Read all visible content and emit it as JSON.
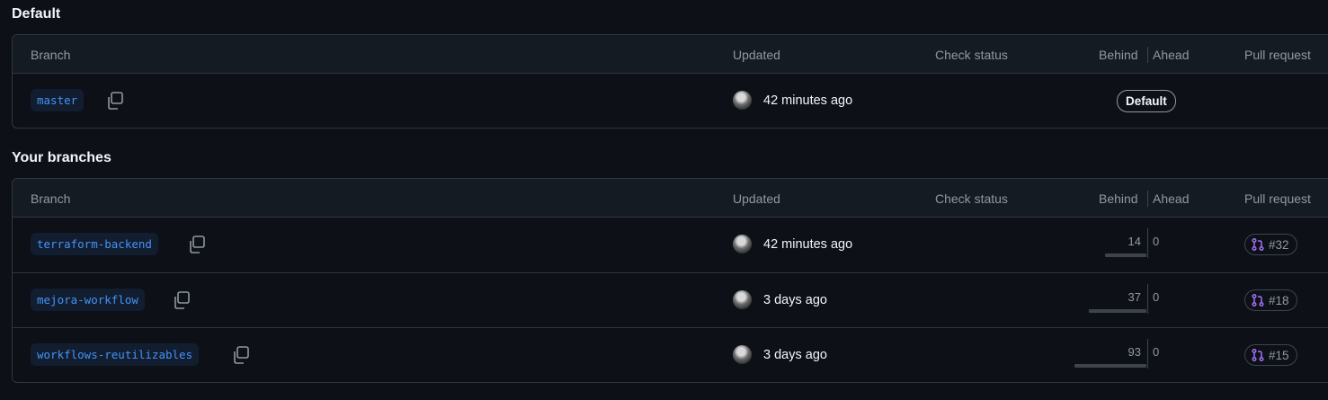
{
  "sections": [
    {
      "title": "Default",
      "headers": {
        "branch": "Branch",
        "updated": "Updated",
        "check_status": "Check status",
        "behind": "Behind",
        "ahead": "Ahead",
        "pull_request": "Pull request"
      },
      "rows": [
        {
          "name": "master",
          "updated": "42 minutes ago",
          "badge": "Default"
        }
      ]
    },
    {
      "title": "Your branches",
      "headers": {
        "branch": "Branch",
        "updated": "Updated",
        "check_status": "Check status",
        "behind": "Behind",
        "ahead": "Ahead",
        "pull_request": "Pull request"
      },
      "rows": [
        {
          "name": "terraform-backend",
          "updated": "42 minutes ago",
          "behind": "14",
          "ahead": "0",
          "pr": "#32"
        },
        {
          "name": "mejora-workflow",
          "updated": "3 days ago",
          "behind": "37",
          "ahead": "0",
          "pr": "#18"
        },
        {
          "name": "workflows-reutilizables",
          "updated": "3 days ago",
          "behind": "93",
          "ahead": "0",
          "pr": "#15"
        }
      ]
    }
  ],
  "colors": {
    "branch_accent": "#4493f8",
    "pr_open": "#a371f7"
  },
  "icons": {
    "copy": "copy-icon",
    "pull_request": "git-pull-request-icon"
  }
}
